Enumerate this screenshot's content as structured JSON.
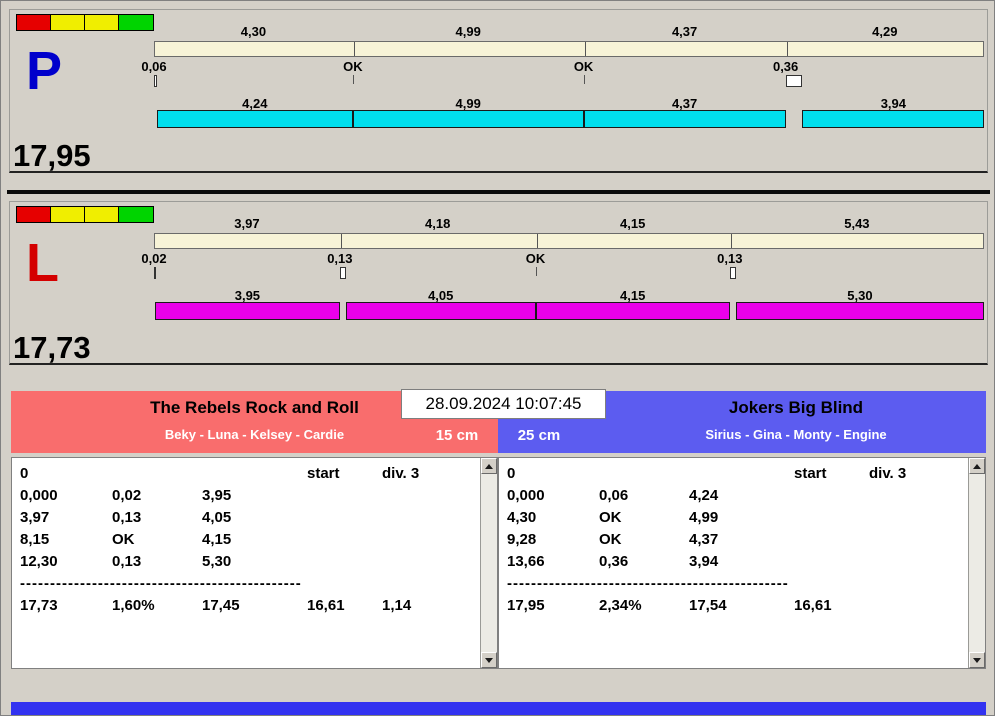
{
  "window": {
    "datetime": "28.09.2024 10:07:45",
    "bg_color": "#d4d0c8",
    "footer_color": "#3232f0"
  },
  "traffic_light": {
    "colors": [
      "#e60000",
      "#f0ee00",
      "#f0ee00",
      "#00d400"
    ]
  },
  "lanes": [
    {
      "letter": "P",
      "letter_color": "#0000cc",
      "total_label": "17,95",
      "bar_color": "#00dfee",
      "splits": [
        {
          "label": "4,30",
          "value": 4.3
        },
        {
          "label": "4,99",
          "value": 4.99
        },
        {
          "label": "4,37",
          "value": 4.37
        },
        {
          "label": "4,29",
          "value": 4.29
        }
      ],
      "markers": [
        {
          "label": "0,06",
          "value": 0.06
        },
        {
          "label": "OK",
          "value": 0
        },
        {
          "label": "OK",
          "value": 0
        },
        {
          "label": "0,36",
          "value": 0.36
        }
      ],
      "runs": [
        {
          "label": "4,24",
          "value": 4.24
        },
        {
          "label": "4,99",
          "value": 4.99
        },
        {
          "label": "4,37",
          "value": 4.37
        },
        {
          "label": "3,94",
          "value": 3.94
        }
      ]
    },
    {
      "letter": "L",
      "letter_color": "#d40000",
      "total_label": "17,73",
      "bar_color": "#ea00ea",
      "splits": [
        {
          "label": "3,97",
          "value": 3.97
        },
        {
          "label": "4,18",
          "value": 4.18
        },
        {
          "label": "4,15",
          "value": 4.15
        },
        {
          "label": "5,43",
          "value": 5.43
        }
      ],
      "markers": [
        {
          "label": "0,02",
          "value": 0.02
        },
        {
          "label": "0,13",
          "value": 0.13
        },
        {
          "label": "OK",
          "value": 0
        },
        {
          "label": "0,13",
          "value": 0.13
        }
      ],
      "runs": [
        {
          "label": "3,95",
          "value": 3.95
        },
        {
          "label": "4,05",
          "value": 4.05
        },
        {
          "label": "4,15",
          "value": 4.15
        },
        {
          "label": "5,30",
          "value": 5.3
        }
      ]
    }
  ],
  "teams": [
    {
      "name": "The Rebels Rock and Roll",
      "dogs": "Beky - Luna - Kelsey - Cardie",
      "height_label": "15 cm",
      "header_color": "#f96d6d",
      "table": {
        "first_row": [
          "0",
          "",
          "",
          "start",
          "div. 3"
        ],
        "split_rows": [
          [
            "0,000",
            "0,02",
            "3,95"
          ],
          [
            "3,97",
            "0,13",
            "4,05"
          ],
          [
            "8,15",
            "OK",
            "4,15"
          ],
          [
            "12,30",
            "0,13",
            "5,30"
          ]
        ],
        "separator": "--------------------------------------------------",
        "total_row": [
          "17,73",
          "1,60%",
          "17,45",
          "16,61",
          "1,14"
        ]
      }
    },
    {
      "name": "Jokers Big Blind",
      "dogs": "Sirius - Gina - Monty - Engine",
      "height_label": "25 cm",
      "header_color": "#5c5cf0",
      "table": {
        "first_row": [
          "0",
          "",
          "",
          "start",
          "div. 3"
        ],
        "split_rows": [
          [
            "0,000",
            "0,06",
            "4,24"
          ],
          [
            "4,30",
            "OK",
            "4,99"
          ],
          [
            "9,28",
            "OK",
            "4,37"
          ],
          [
            "13,66",
            "0,36",
            "3,94"
          ]
        ],
        "separator": "--------------------------------------------------",
        "total_row": [
          "17,95",
          "2,34%",
          "17,54",
          "16,61",
          ""
        ]
      }
    }
  ]
}
